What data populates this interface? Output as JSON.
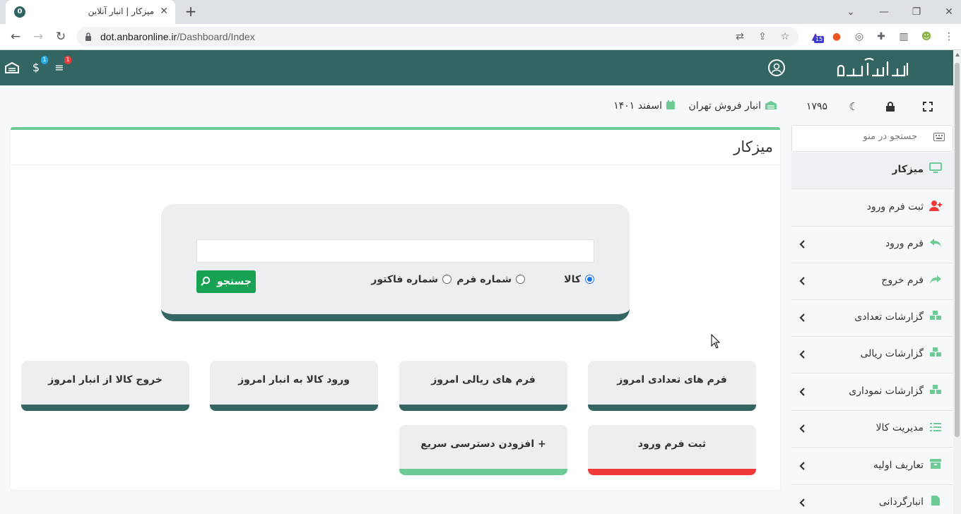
{
  "browser": {
    "tab_title": "میزکار | انبار آنلاین",
    "tab_favicon_text": "0",
    "url_host": "dot.anbaronline.ir",
    "url_path": "/Dashboard/Index",
    "extension_badge": "15"
  },
  "header": {
    "notif_badge_1": "1",
    "notif_badge_2": "1"
  },
  "sidebar": {
    "tool_number": "۱۷۹۵",
    "search_placeholder": "جستجو در منو",
    "items": [
      {
        "label": "میزکار",
        "icon": "desktop-icon",
        "color": "#6fcb95"
      },
      {
        "label": "ثبت فرم ورود",
        "icon": "user-plus-icon",
        "color": "#ef3a3a"
      },
      {
        "label": "فرم ورود",
        "icon": "reply-icon",
        "color": "#6fcb95"
      },
      {
        "label": "فرم خروج",
        "icon": "share-icon",
        "color": "#6fcb95"
      },
      {
        "label": "گزارشات تعدادی",
        "icon": "cubes-icon",
        "color": "#6fcb95"
      },
      {
        "label": "گزارشات ریالی",
        "icon": "cubes-icon",
        "color": "#6fcb95"
      },
      {
        "label": "گزارشات نموداری",
        "icon": "cubes-icon",
        "color": "#6fcb95"
      },
      {
        "label": "مدیریت کالا",
        "icon": "list-icon",
        "color": "#6fcb95"
      },
      {
        "label": "تعاریف اولیه",
        "icon": "archive-icon",
        "color": "#6fcb95"
      },
      {
        "label": "انبارگردانی",
        "icon": "file-icon",
        "color": "#6fcb95"
      }
    ]
  },
  "info": {
    "warehouse": "انبار فروش تهران",
    "date": "اسفند ۱۴۰۱"
  },
  "main": {
    "title": "میزکار",
    "search": {
      "options": [
        "کالا",
        "شماره فرم",
        "شماره فاکتور"
      ],
      "selected": "کالا",
      "button": "جستجو"
    },
    "quick_cards": [
      "فرم های تعدادی امروز",
      "فرم های ریالی امروز",
      "ورود کالا به انبار امروز",
      "خروج کالا از انبار امروز",
      "ثبت فرم ورود",
      "+ افزودن دسترسی سریع"
    ]
  },
  "colors": {
    "primary": "#336562",
    "accent_green": "#6fcb95",
    "accent_red": "#ef3a3a",
    "button_green": "#19a254"
  }
}
